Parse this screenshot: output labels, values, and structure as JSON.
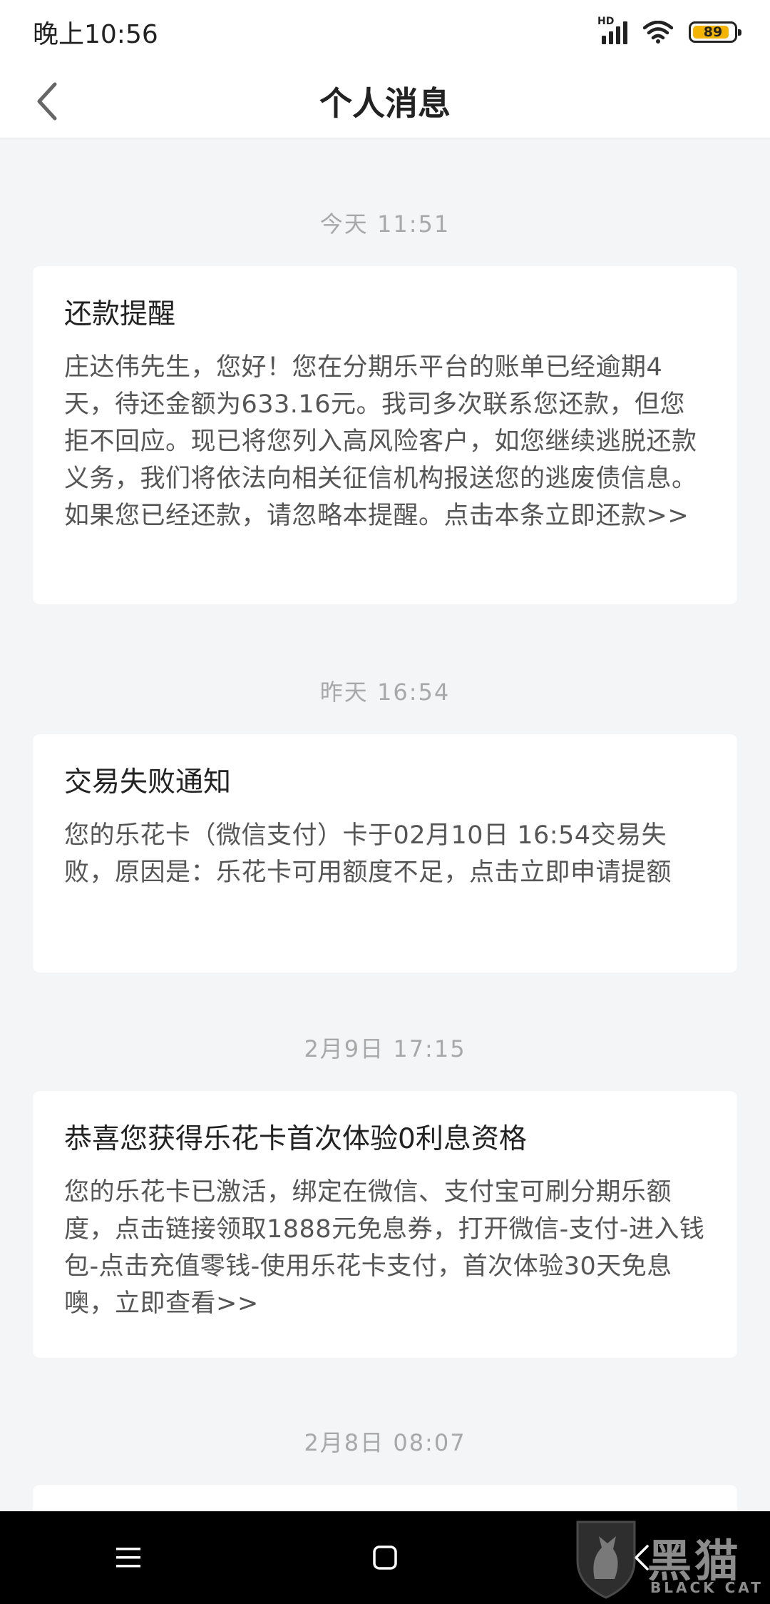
{
  "status_bar": {
    "time": "晚上10:56",
    "network_label": "HD",
    "battery_level": "89",
    "icons": [
      "signal-icon",
      "wifi-icon",
      "battery-icon"
    ]
  },
  "header": {
    "title": "个人消息",
    "back_icon": "chevron-left-icon"
  },
  "messages": [
    {
      "time": "今天  11:51",
      "title": "还款提醒",
      "body": "庄达伟先生，您好！您在分期乐平台的账单已经逾期4天，待还金额为633.16元。我司多次联系您还款，但您拒不回应。现已将您列入高风险客户，如您继续逃脱还款义务，我们将依法向相关征信机构报送您的逃废债信息。如果您已经还款，请忽略本提醒。点击本条立即还款>>"
    },
    {
      "time": "昨天  16:54",
      "title": "交易失败通知",
      "body": "您的乐花卡（微信支付）卡于02月10日  16:54交易失败，原因是：乐花卡可用额度不足，点击立即申请提额"
    },
    {
      "time": "2月9日  17:15",
      "title": "恭喜您获得乐花卡首次体验0利息资格",
      "body": "您的乐花卡已激活，绑定在微信、支付宝可刷分期乐额度，点击链接领取1888元免息券，打开微信-支付-进入钱包-点击充值零钱-使用乐花卡支付，首次体验30天免息噢，立即查看>>"
    },
    {
      "time": "2月8日  08:07"
    }
  ],
  "nav_bar": {
    "icons": [
      "menu-icon",
      "home-square-icon",
      "back-triangle-icon"
    ]
  },
  "watermark": {
    "text": "黑猫",
    "subtext": "BLACK CAT"
  },
  "colors": {
    "background": "#f4f5f7",
    "card": "#ffffff",
    "time_label": "#a8a8a8",
    "battery": "#f2b400",
    "nav_bar": "#000000"
  }
}
